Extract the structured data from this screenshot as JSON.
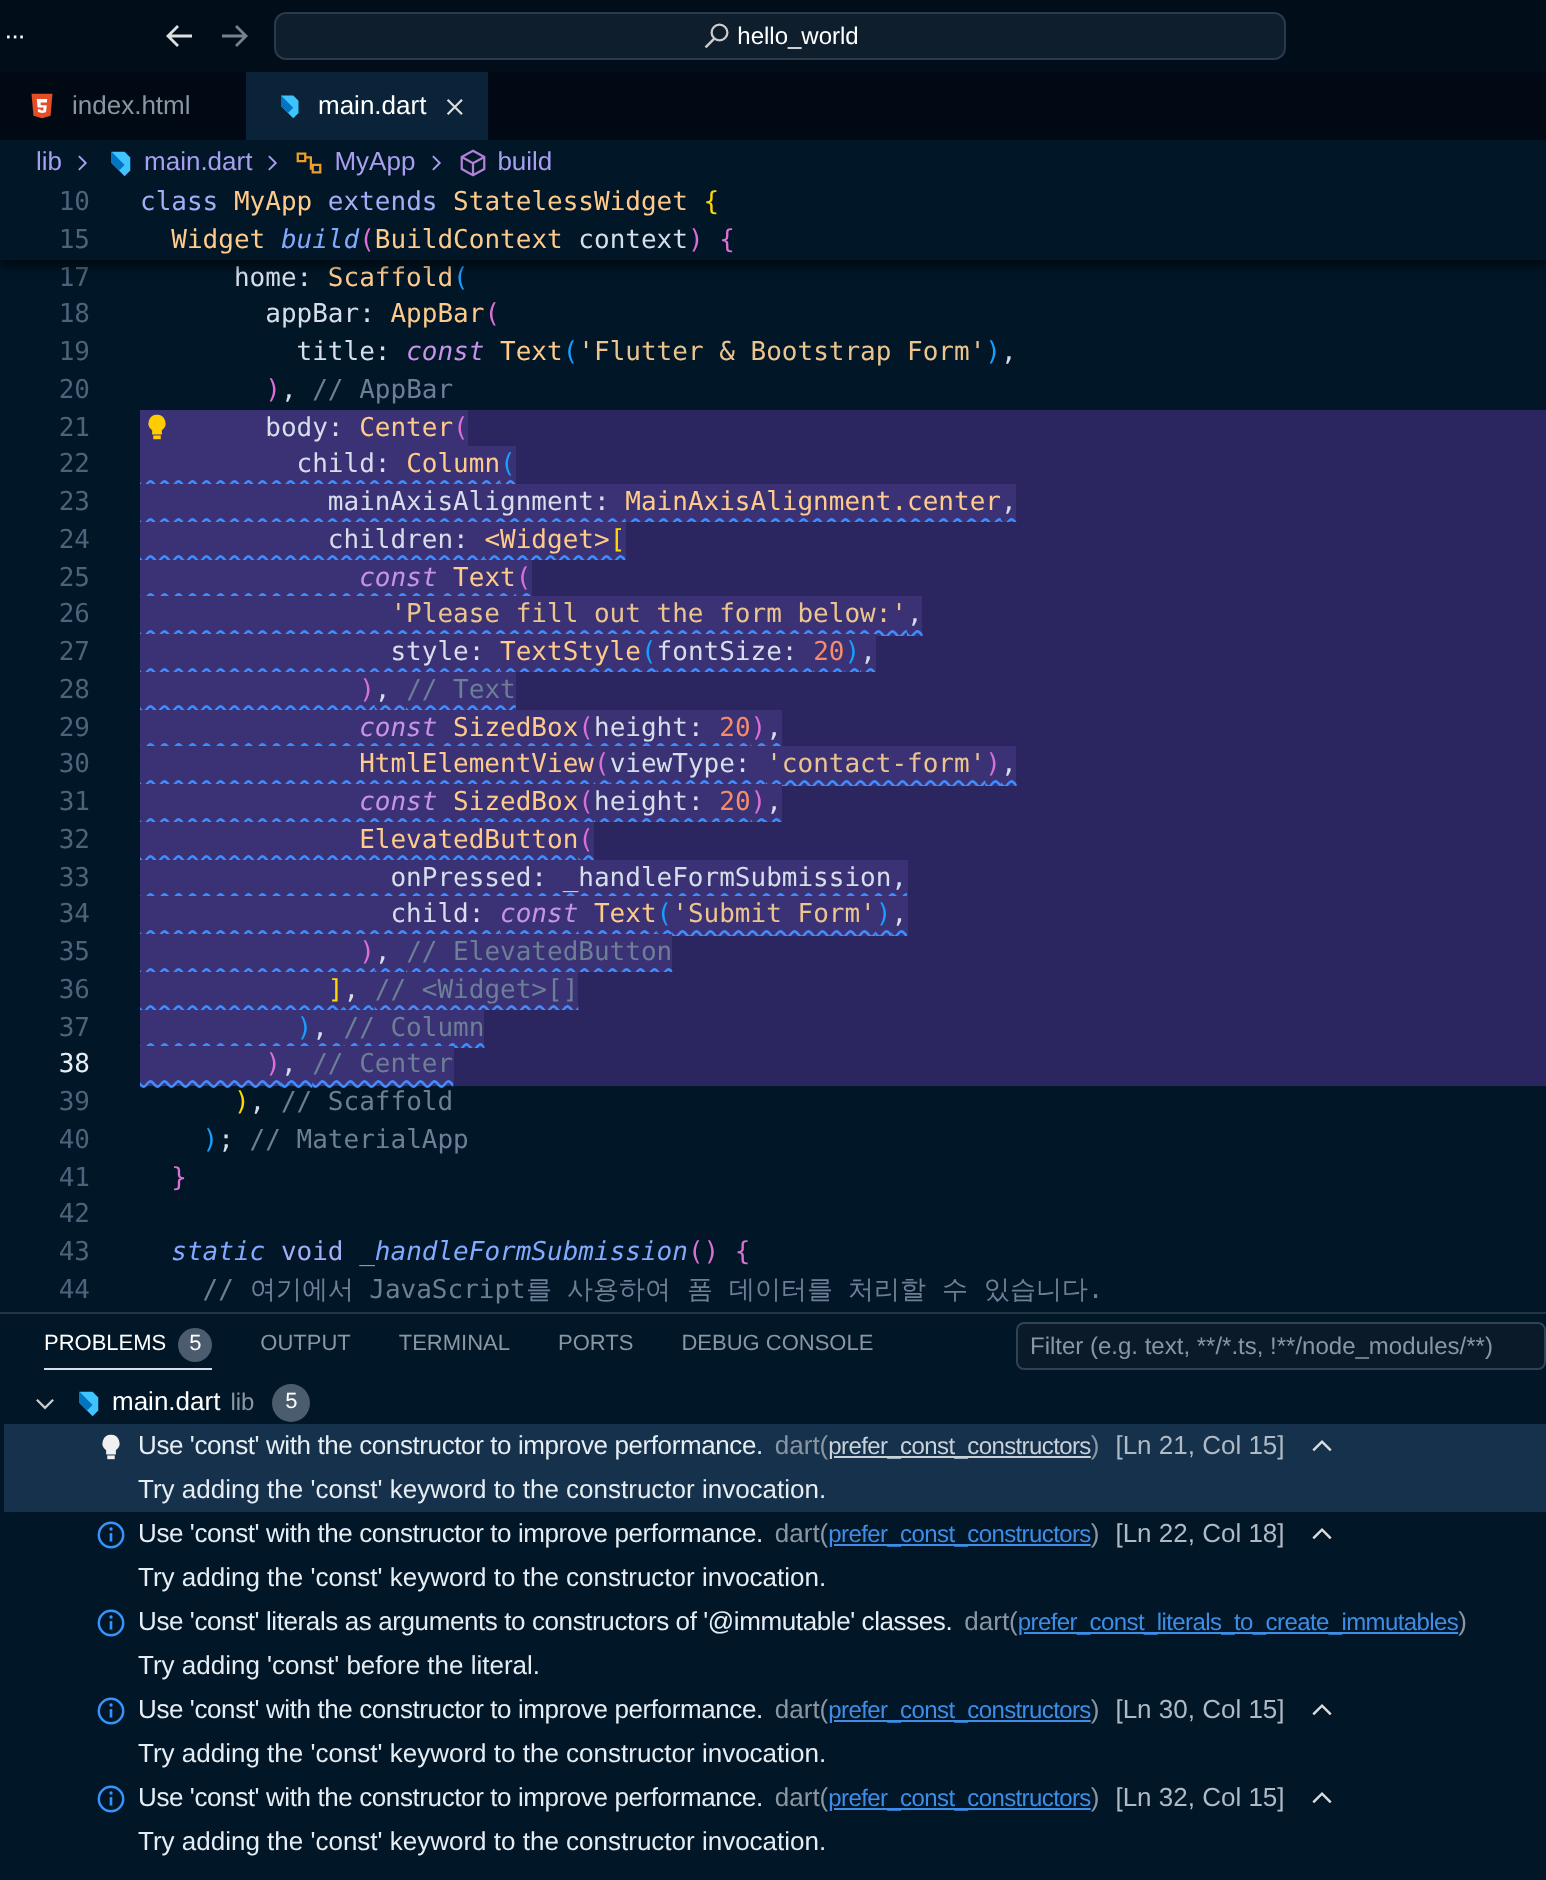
{
  "title_bar": {
    "menu": "···",
    "search": "hello_world"
  },
  "tabs": [
    {
      "label": "index.html",
      "kind": "html",
      "selected": false
    },
    {
      "label": "main.dart",
      "kind": "dart",
      "selected": true
    }
  ],
  "breadcrumb": [
    {
      "label": "lib",
      "kind": "folder"
    },
    {
      "label": "main.dart",
      "kind": "dart"
    },
    {
      "label": "MyApp",
      "kind": "class"
    },
    {
      "label": "build",
      "kind": "method"
    }
  ],
  "sticky_lines": [
    {
      "number": "10",
      "tokens": [
        {
          "kind": "kw",
          "text": "class"
        },
        {
          "kind": "type",
          "text": " MyApp"
        },
        {
          "kind": "kw",
          "text": " extends"
        },
        {
          "kind": "type",
          "text": " StatelessWidget"
        },
        {
          "kind": "yb",
          "text": " {"
        }
      ]
    },
    {
      "number": "15",
      "tokens": [
        {
          "kind": "type",
          "text": "  Widget"
        },
        {
          "kind": "fn",
          "text": " build"
        },
        {
          "kind": "pb",
          "text": "("
        },
        {
          "kind": "type",
          "text": "BuildContext"
        },
        {
          "kind": "prop",
          "text": " context"
        },
        {
          "kind": "pb",
          "text": ")"
        },
        {
          "kind": "pb",
          "text": " {"
        }
      ]
    }
  ],
  "lines": [
    {
      "number": "17",
      "selected": false,
      "squiggle": false,
      "current": false,
      "lightbulb": false,
      "tokens": [
        {
          "kind": "prop",
          "text": "      home: "
        },
        {
          "kind": "type",
          "text": "Scaffold"
        },
        {
          "kind": "bb",
          "text": "("
        }
      ]
    },
    {
      "number": "18",
      "selected": false,
      "squiggle": false,
      "current": false,
      "lightbulb": false,
      "tokens": [
        {
          "kind": "prop",
          "text": "        appBar: "
        },
        {
          "kind": "type",
          "text": "AppBar"
        },
        {
          "kind": "pb",
          "text": "("
        }
      ]
    },
    {
      "number": "19",
      "selected": false,
      "squiggle": false,
      "current": false,
      "lightbulb": false,
      "tokens": [
        {
          "kind": "prop",
          "text": "          title: "
        },
        {
          "kind": "const",
          "text": "const"
        },
        {
          "kind": "type",
          "text": " Text"
        },
        {
          "kind": "bb",
          "text": "("
        },
        {
          "kind": "str",
          "text": "'Flutter & Bootstrap Form'"
        },
        {
          "kind": "bb",
          "text": ")"
        },
        {
          "kind": "prop",
          "text": ","
        }
      ]
    },
    {
      "number": "20",
      "selected": false,
      "squiggle": false,
      "current": false,
      "lightbulb": false,
      "tokens": [
        {
          "kind": "pb",
          "text": "        )"
        },
        {
          "kind": "prop",
          "text": ", "
        },
        {
          "kind": "cm",
          "text": "// AppBar"
        }
      ]
    },
    {
      "number": "21",
      "selected": true,
      "squiggle": false,
      "current": false,
      "lightbulb": true,
      "tokens": [
        {
          "kind": "prop",
          "text": "        body: "
        },
        {
          "kind": "type",
          "text": "Center"
        },
        {
          "kind": "pb",
          "text": "("
        }
      ]
    },
    {
      "number": "22",
      "selected": true,
      "squiggle": true,
      "current": false,
      "lightbulb": false,
      "tokens": [
        {
          "kind": "prop",
          "text": "          child: "
        },
        {
          "kind": "type",
          "text": "Column"
        },
        {
          "kind": "bb",
          "text": "("
        }
      ]
    },
    {
      "number": "23",
      "selected": true,
      "squiggle": true,
      "current": false,
      "lightbulb": false,
      "tokens": [
        {
          "kind": "prop",
          "text": "            mainAxisAlignment: "
        },
        {
          "kind": "type",
          "text": "MainAxisAlignment.center"
        },
        {
          "kind": "prop",
          "text": ","
        }
      ]
    },
    {
      "number": "24",
      "selected": true,
      "squiggle": true,
      "current": false,
      "lightbulb": false,
      "tokens": [
        {
          "kind": "prop",
          "text": "            children: "
        },
        {
          "kind": "type",
          "text": "<Widget>"
        },
        {
          "kind": "yb",
          "text": "["
        }
      ]
    },
    {
      "number": "25",
      "selected": true,
      "squiggle": true,
      "current": false,
      "lightbulb": false,
      "tokens": [
        {
          "kind": "const",
          "text": "              const"
        },
        {
          "kind": "type",
          "text": " Text"
        },
        {
          "kind": "pb",
          "text": "("
        }
      ]
    },
    {
      "number": "26",
      "selected": true,
      "squiggle": true,
      "current": false,
      "lightbulb": false,
      "tokens": [
        {
          "kind": "str",
          "text": "                'Please fill out the form below:'"
        },
        {
          "kind": "prop",
          "text": ","
        }
      ]
    },
    {
      "number": "27",
      "selected": true,
      "squiggle": true,
      "current": false,
      "lightbulb": false,
      "tokens": [
        {
          "kind": "prop",
          "text": "                style: "
        },
        {
          "kind": "type",
          "text": "TextStyle"
        },
        {
          "kind": "bb",
          "text": "("
        },
        {
          "kind": "prop",
          "text": "fontSize: "
        },
        {
          "kind": "num",
          "text": "20"
        },
        {
          "kind": "bb",
          "text": ")"
        },
        {
          "kind": "prop",
          "text": ","
        }
      ]
    },
    {
      "number": "28",
      "selected": true,
      "squiggle": true,
      "current": false,
      "lightbulb": false,
      "tokens": [
        {
          "kind": "pb",
          "text": "              )"
        },
        {
          "kind": "prop",
          "text": ", "
        },
        {
          "kind": "cm",
          "text": "// Text"
        }
      ]
    },
    {
      "number": "29",
      "selected": true,
      "squiggle": true,
      "current": false,
      "lightbulb": false,
      "tokens": [
        {
          "kind": "const",
          "text": "              const"
        },
        {
          "kind": "type",
          "text": " SizedBox"
        },
        {
          "kind": "pb",
          "text": "("
        },
        {
          "kind": "prop",
          "text": "height: "
        },
        {
          "kind": "num",
          "text": "20"
        },
        {
          "kind": "pb",
          "text": ")"
        },
        {
          "kind": "prop",
          "text": ","
        }
      ]
    },
    {
      "number": "30",
      "selected": true,
      "squiggle": true,
      "current": false,
      "lightbulb": false,
      "tokens": [
        {
          "kind": "type",
          "text": "              HtmlElementView"
        },
        {
          "kind": "pb",
          "text": "("
        },
        {
          "kind": "prop",
          "text": "viewType: "
        },
        {
          "kind": "str",
          "text": "'contact-form'"
        },
        {
          "kind": "pb",
          "text": ")"
        },
        {
          "kind": "prop",
          "text": ","
        }
      ]
    },
    {
      "number": "31",
      "selected": true,
      "squiggle": true,
      "current": false,
      "lightbulb": false,
      "tokens": [
        {
          "kind": "const",
          "text": "              const"
        },
        {
          "kind": "type",
          "text": " SizedBox"
        },
        {
          "kind": "pb",
          "text": "("
        },
        {
          "kind": "prop",
          "text": "height: "
        },
        {
          "kind": "num",
          "text": "20"
        },
        {
          "kind": "pb",
          "text": ")"
        },
        {
          "kind": "prop",
          "text": ","
        }
      ]
    },
    {
      "number": "32",
      "selected": true,
      "squiggle": true,
      "current": false,
      "lightbulb": false,
      "tokens": [
        {
          "kind": "type",
          "text": "              ElevatedButton"
        },
        {
          "kind": "pb",
          "text": "("
        }
      ]
    },
    {
      "number": "33",
      "selected": true,
      "squiggle": true,
      "current": false,
      "lightbulb": false,
      "tokens": [
        {
          "kind": "prop",
          "text": "                onPressed: _handleFormSubmission,"
        }
      ]
    },
    {
      "number": "34",
      "selected": true,
      "squiggle": true,
      "current": false,
      "lightbulb": false,
      "tokens": [
        {
          "kind": "prop",
          "text": "                child: "
        },
        {
          "kind": "const",
          "text": "const"
        },
        {
          "kind": "type",
          "text": " Text"
        },
        {
          "kind": "bb",
          "text": "("
        },
        {
          "kind": "str",
          "text": "'Submit Form'"
        },
        {
          "kind": "bb",
          "text": ")"
        },
        {
          "kind": "prop",
          "text": ","
        }
      ]
    },
    {
      "number": "35",
      "selected": true,
      "squiggle": true,
      "current": false,
      "lightbulb": false,
      "tokens": [
        {
          "kind": "pb",
          "text": "              )"
        },
        {
          "kind": "prop",
          "text": ", "
        },
        {
          "kind": "cm",
          "text": "// ElevatedButton"
        }
      ]
    },
    {
      "number": "36",
      "selected": true,
      "squiggle": true,
      "current": false,
      "lightbulb": false,
      "tokens": [
        {
          "kind": "yb",
          "text": "            ]"
        },
        {
          "kind": "prop",
          "text": ", "
        },
        {
          "kind": "cm",
          "text": "// <Widget>[]"
        }
      ]
    },
    {
      "number": "37",
      "selected": true,
      "squiggle": true,
      "current": false,
      "lightbulb": false,
      "tokens": [
        {
          "kind": "bb",
          "text": "          )"
        },
        {
          "kind": "prop",
          "text": ", "
        },
        {
          "kind": "cm",
          "text": "// Column"
        }
      ]
    },
    {
      "number": "38",
      "selected": true,
      "squiggle": true,
      "current": true,
      "lightbulb": false,
      "tokens": [
        {
          "kind": "pb",
          "text": "        )"
        },
        {
          "kind": "prop",
          "text": ", "
        },
        {
          "kind": "cm",
          "text": "// Center"
        }
      ]
    },
    {
      "number": "39",
      "selected": false,
      "squiggle": false,
      "current": false,
      "lightbulb": false,
      "tokens": [
        {
          "kind": "yb",
          "text": "      )"
        },
        {
          "kind": "prop",
          "text": ", "
        },
        {
          "kind": "cm",
          "text": "// Scaffold"
        }
      ]
    },
    {
      "number": "40",
      "selected": false,
      "squiggle": false,
      "current": false,
      "lightbulb": false,
      "tokens": [
        {
          "kind": "bb",
          "text": "    )"
        },
        {
          "kind": "prop",
          "text": "; "
        },
        {
          "kind": "cm",
          "text": "// MaterialApp"
        }
      ]
    },
    {
      "number": "41",
      "selected": false,
      "squiggle": false,
      "current": false,
      "lightbulb": false,
      "tokens": [
        {
          "kind": "pb",
          "text": "  }"
        }
      ]
    },
    {
      "number": "42",
      "selected": false,
      "squiggle": false,
      "current": false,
      "lightbulb": false
    },
    {
      "number": "43",
      "selected": false,
      "squiggle": false,
      "current": false,
      "lightbulb": false,
      "tokens": [
        {
          "kind": "fn",
          "text": "  static"
        },
        {
          "kind": "kw",
          "text": " void"
        },
        {
          "kind": "fn",
          "text": " _handleFormSubmission"
        },
        {
          "kind": "pb",
          "text": "()"
        },
        {
          "kind": "pb",
          "text": " {"
        }
      ]
    },
    {
      "number": "44",
      "selected": false,
      "squiggle": false,
      "current": false,
      "lightbulb": false,
      "tokens": [
        {
          "kind": "cm",
          "text": "    // 여기에서 JavaScript를 사용하여 폼 데이터를 처리할 수 있습니다."
        }
      ]
    }
  ],
  "panel": {
    "tabs": [
      {
        "label": "PROBLEMS",
        "badge": "5",
        "selected": true
      },
      {
        "label": "OUTPUT",
        "selected": false
      },
      {
        "label": "TERMINAL",
        "selected": false
      },
      {
        "label": "PORTS",
        "selected": false
      },
      {
        "label": "DEBUG CONSOLE",
        "selected": false
      }
    ],
    "filter": {
      "placeholder": "Filter (e.g. text, **/*.ts, !**/node_modules/**)"
    },
    "file": {
      "name": "main.dart",
      "folder": "lib",
      "count": "5",
      "expanded": true
    },
    "problems": [
      {
        "kind": "lightbulb",
        "selected": true,
        "message": "Use 'const' with the constructor to improve performance.",
        "source": "dart(",
        "rule": "prefer_const_constructors",
        "source_end": ")",
        "location": "[Ln 21, Col 15]",
        "detail": "Try adding the 'const' keyword to the constructor invocation."
      },
      {
        "kind": "info",
        "selected": false,
        "message": "Use 'const' with the constructor to improve performance.",
        "source": "dart(",
        "rule": "prefer_const_constructors",
        "source_end": ")",
        "location": "[Ln 22, Col 18]",
        "detail": "Try adding the 'const' keyword to the constructor invocation."
      },
      {
        "kind": "info",
        "selected": false,
        "message": "Use 'const' literals as arguments to constructors of '@immutable' classes.",
        "source": "dart(",
        "rule": "prefer_const_literals_to_create_immutables",
        "source_end": ")",
        "detail": "Try adding 'const' before the literal."
      },
      {
        "kind": "info",
        "selected": false,
        "message": "Use 'const' with the constructor to improve performance.",
        "source": "dart(",
        "rule": "prefer_const_constructors",
        "source_end": ")",
        "location": "[Ln 30, Col 15]",
        "detail": "Try adding the 'const' keyword to the constructor invocation."
      },
      {
        "kind": "info",
        "selected": false,
        "message": "Use 'const' with the constructor to improve performance.",
        "source": "dart(",
        "rule": "prefer_const_constructors",
        "source_end": ")",
        "location": "[Ln 32, Col 15]",
        "detail": "Try adding the 'const' keyword to the constructor invocation."
      }
    ]
  }
}
